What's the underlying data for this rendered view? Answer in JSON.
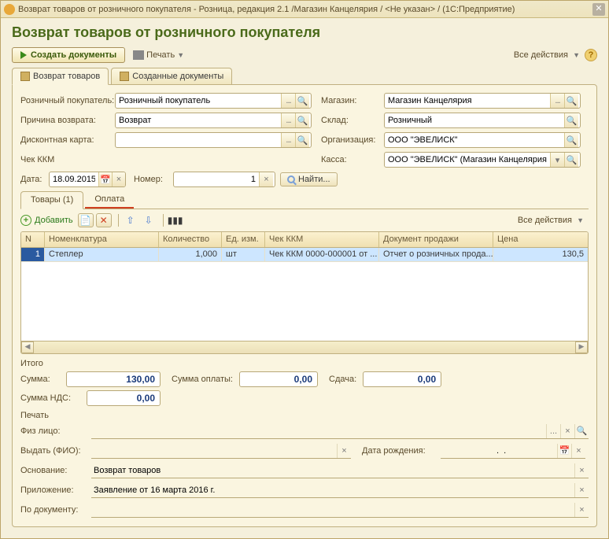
{
  "window": {
    "title": "Возврат товаров от розничного покупателя - Розница, редакция 2.1 /Магазин Канцелярия / <Не указан> / (1С:Предприятие)"
  },
  "header": "Возврат товаров от розничного покупателя",
  "toolbar": {
    "create_docs": "Создать документы",
    "print": "Печать",
    "all_actions": "Все действия"
  },
  "outer_tabs": {
    "return_goods": "Возврат товаров",
    "created_docs": "Созданные документы"
  },
  "form": {
    "retail_customer_label": "Розничный покупатель:",
    "retail_customer_value": "Розничный покупатель",
    "store_label": "Магазин:",
    "store_value": "Магазин Канцелярия",
    "reason_label": "Причина возврата:",
    "reason_value": "Возврат",
    "warehouse_label": "Склад:",
    "warehouse_value": "Розничный",
    "discount_card_label": "Дисконтная карта:",
    "discount_card_value": "",
    "org_label": "Организация:",
    "org_value": "ООО \"ЭВЕЛИСК\"",
    "kkm_check_label": "Чек ККМ",
    "cashdesk_label": "Касса:",
    "cashdesk_value": "ООО \"ЭВЕЛИСК\" (Магазин Канцелярия)",
    "date_label": "Дата:",
    "date_value": "18.09.2015",
    "number_label": "Номер:",
    "number_value": "1",
    "find_label": "Найти..."
  },
  "inner_tabs": {
    "goods": "Товары (1)",
    "payment": "Оплата"
  },
  "sub_toolbar": {
    "add": "Добавить",
    "all_actions": "Все действия"
  },
  "table": {
    "columns": {
      "n": "N",
      "nomenclature": "Номенклатура",
      "qty": "Количество",
      "unit": "Ед. изм.",
      "kkm": "Чек ККМ",
      "sale_doc": "Документ продажи",
      "price": "Цена"
    },
    "rows": [
      {
        "n": "1",
        "nomenclature": "Степлер",
        "qty": "1,000",
        "unit": "шт",
        "kkm": "Чек ККМ 0000-000001 от ...",
        "sale_doc": "Отчет о розничных прода...",
        "price": "130,5"
      }
    ]
  },
  "totals": {
    "itogo_label": "Итого",
    "sum_label": "Сумма:",
    "sum_value": "130,00",
    "payment_sum_label": "Сумма оплаты:",
    "payment_sum_value": "0,00",
    "change_label": "Сдача:",
    "change_value": "0,00",
    "vat_label": "Сумма НДС:",
    "vat_value": "0,00"
  },
  "print_section": {
    "label": "Печать",
    "individual_label": "Физ лицо:",
    "individual_value": "",
    "issue_to_label": "Выдать (ФИО):",
    "issue_to_value": "",
    "dob_label": "Дата рождения:",
    "dob_value": "  .  .",
    "basis_label": "Основание:",
    "basis_value": "Возврат товаров",
    "attachment_label": "Приложение:",
    "attachment_value": "Заявление от 16 марта 2016 г.",
    "by_doc_label": "По документу:",
    "by_doc_value": ""
  }
}
